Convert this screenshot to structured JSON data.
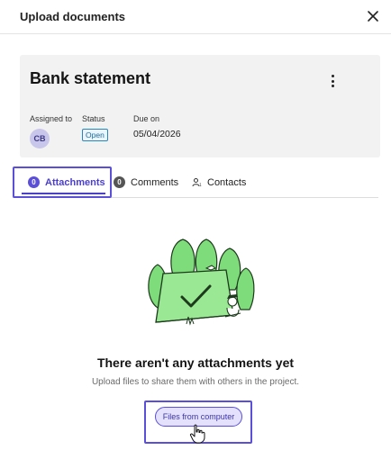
{
  "header": {
    "title": "Upload documents",
    "close_icon": "close-icon"
  },
  "card": {
    "title": "Bank statement",
    "menu_icon": "more-vertical-icon",
    "assigned_label": "Assigned to",
    "assignee_initials": "CB",
    "status_label": "Status",
    "status_value": "Open",
    "due_label": "Due on",
    "due_value": "05/04/2026"
  },
  "tabs": [
    {
      "label": "Attachments",
      "count": "0",
      "selected": true
    },
    {
      "label": "Comments",
      "count": "0",
      "selected": false
    },
    {
      "label": "Contacts",
      "icon": "contacts-icon",
      "selected": false
    }
  ],
  "empty_state": {
    "illustration": "folder-checkmark-illustration",
    "title": "There aren't any attachments yet",
    "description": "Upload files to share them with others in the project.",
    "upload_button": "Files from computer",
    "cursor_icon": "hand-pointer-icon"
  },
  "colors": {
    "accent": "#5b4fd9",
    "status_blue": "#2a86b8",
    "avatar_bg": "#c8c6ea",
    "card_bg": "#f2f2f2",
    "illustration_green": "#7fdc7a"
  }
}
